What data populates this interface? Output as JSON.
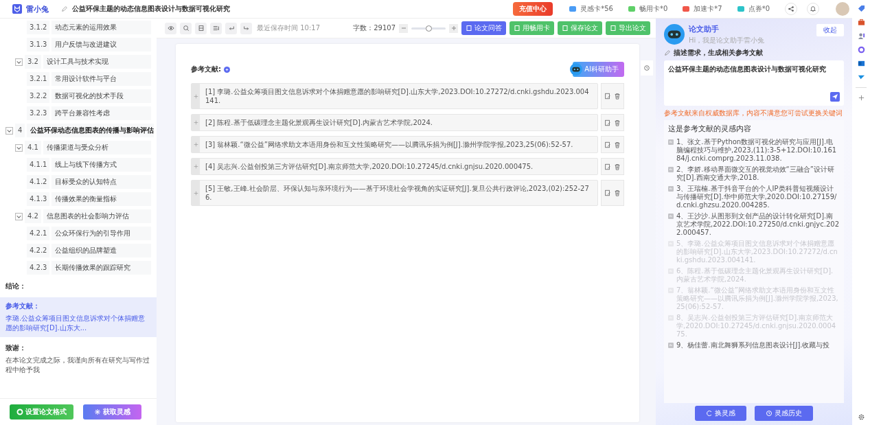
{
  "app": {
    "logo_text": "雷小兔",
    "doc_title": "公益环保主题的动态信息图表设计与数据可视化研究",
    "recharge": "充值中心",
    "cards": [
      {
        "label": "灵感卡*56",
        "color": "#4a9cf5"
      },
      {
        "label": "畅用卡*0",
        "color": "#5fd068"
      },
      {
        "label": "加速卡*7",
        "color": "#f0574a"
      },
      {
        "label": "点券*0",
        "color": "#2cc3c9"
      }
    ]
  },
  "outline": [
    {
      "children": [
        {
          "children": [
            {
              "num": "3.1.2",
              "title": "动态元素的运用效果"
            },
            {
              "num": "3.1.3",
              "title": "用户反馈与改进建议"
            }
          ]
        },
        {
          "num": "3.2",
          "title": "设计工具与技术实现",
          "expanded": true,
          "children": [
            {
              "num": "3.2.1",
              "title": "常用设计软件与平台"
            },
            {
              "num": "3.2.2",
              "title": "数据可视化的技术手段"
            },
            {
              "num": "3.2.3",
              "title": "跨平台兼容性考虑"
            }
          ]
        }
      ]
    },
    {
      "num": "4",
      "title": "公益环保动态信息图表的传播与影响评估",
      "expanded": true,
      "children": [
        {
          "num": "4.1",
          "title": "传播渠道与受众分析",
          "expanded": true,
          "children": [
            {
              "num": "4.1.1",
              "title": "线上与线下传播方式"
            },
            {
              "num": "4.1.2",
              "title": "目标受众的认知特点"
            },
            {
              "num": "4.1.3",
              "title": "传播效果的衡量指标"
            }
          ]
        },
        {
          "num": "4.2",
          "title": "信息图表的社会影响力评估",
          "expanded": true,
          "children": [
            {
              "num": "4.2.1",
              "title": "公众环保行为的引导作用"
            },
            {
              "num": "4.2.2",
              "title": "公益组织的品牌塑造"
            },
            {
              "num": "4.2.3",
              "title": "长期传播效果的跟踪研究"
            }
          ]
        }
      ]
    }
  ],
  "sections": [
    {
      "title": "结论：",
      "selected": false
    },
    {
      "title": "参考文献：",
      "selected": true,
      "text": "李璐.公益众筹项目图文信息诉求对个体捐赠意愿的影响研究[D].山东大..."
    },
    {
      "title": "致谢：",
      "selected": false,
      "text": "在本论文完成之际，我谨向所有在研究与写作过程中给予我"
    }
  ],
  "left_buttons": [
    "设置论文格式",
    "获取灵感"
  ],
  "toolbar": {
    "save_time": "最近保存时间 10:17",
    "word_count": "字数：29107",
    "zoom": {
      "level": 0.5
    },
    "buttons": [
      {
        "label": "论文问答",
        "kind": "primary"
      },
      {
        "label": "用畅用卡",
        "kind": "success"
      },
      {
        "label": "保存论文",
        "kind": "success"
      },
      {
        "label": "导出论文",
        "kind": "success"
      }
    ]
  },
  "document": {
    "heading": "参考文献:",
    "ai_button": "AI科研助手",
    "references": [
      "[1] 李璐.公益众筹项目图文信息诉求对个体捐赠意愿的影响研究[D].山东大学,2023.DOI:10.27272/d.cnki.gshdu.2023.004141.",
      "[2] 陈程.基于低碳理念主题化景观再生设计研究[D].内蒙古艺术学院,2024.",
      "[3] 翁林颖.“微公益”网络求助文本语用身份和互文性策略研究——以腾讯乐捐为例[J].滁州学院学报,2023,25(06):52-57.",
      "[4] 吴志兴.公益创投第三方评估研究[D].南京师范大学,2020.DOI:10.27245/d.cnki.gnjsu.2020.000475.",
      "[5] 王敏,王峰.社会阶层、环保认知与亲环境行为——基于环境社会学视角的实证研究[J].复旦公共行政评论,2023,(02):252-276."
    ]
  },
  "assistant": {
    "title": "论文助手",
    "greeting": "Hi，我是论文助手雷小兔",
    "collapse": "收起",
    "prompt_label": "描述需求，生成相关参考文献",
    "input_value": "公益环保主题的动态信息图表设计与数据可视化研究",
    "hint": "参考文献来自权威数据库，内容不满意您可尝试更换关键词",
    "list_title": "这是参考文献的灵感内容",
    "items": [
      {
        "text": "1、张文.基于Python数据可视化的研究与应用[J].电脑编程技巧与维护,2023,(11):3-5+12.DOI:10.16184/j.cnki.comprg.2023.11.038.",
        "faded": false
      },
      {
        "text": "2、李娇.移动界面微交互的视觉动效“三融合”设计研究[D].西南交通大学,2018.",
        "faded": false
      },
      {
        "text": "3、王瑞楠.基于抖音平台的个人IP类科普短视频设计与传播研究[D].华中师范大学,2020.DOI:10.27159/d.cnki.ghzsu.2020.004285.",
        "faded": false
      },
      {
        "text": "4、王沙沙.从图形到文创产品的设计转化研究[D].南京艺术学院,2022.DOI:10.27250/d.cnki.gnjyc.2022.000457.",
        "faded": false
      },
      {
        "text": "5、李璐.公益众筹项目图文信息诉求对个体捐赠意愿的影响研究[D].山东大学,2023.DOI:10.27272/d.cnki.gshdu.2023.004141.",
        "faded": true
      },
      {
        "text": "6、陈程.基于低碳理念主题化景观再生设计研究[D].内蒙古艺术学院,2024.",
        "faded": true
      },
      {
        "text": "7、翁林颖.“微公益”网络求助文本语用身份和互文性策略研究——以腾讯乐捐为例[J].滁州学院学报,2023,25(06):52-57.",
        "faded": true
      },
      {
        "text": "8、吴志兴.公益创投第三方评估研究[D].南京师范大学,2020.DOI:10.27245/d.cnki.gnjsu.2020.000475.",
        "faded": true
      },
      {
        "text": "9、杨佳蕾.南北舞狮系列信息图表设计[J].收藏与投",
        "faded": false
      }
    ],
    "buttons": [
      "换灵感",
      "灵感历史"
    ]
  }
}
